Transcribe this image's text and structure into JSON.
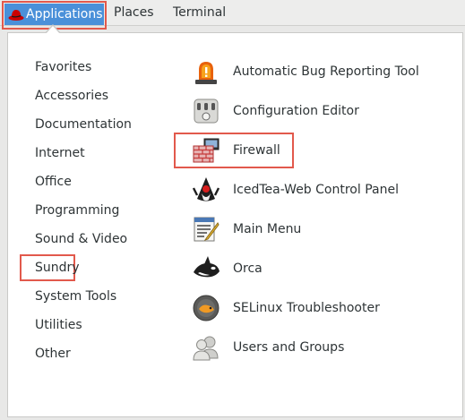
{
  "topbar": {
    "applications_label": "Applications",
    "places_label": "Places",
    "terminal_label": "Terminal"
  },
  "categories": [
    {
      "label": "Favorites"
    },
    {
      "label": "Accessories"
    },
    {
      "label": "Documentation"
    },
    {
      "label": "Internet"
    },
    {
      "label": "Office"
    },
    {
      "label": "Programming"
    },
    {
      "label": "Sound & Video"
    },
    {
      "label": "Sundry",
      "selected": true
    },
    {
      "label": "System Tools"
    },
    {
      "label": "Utilities"
    },
    {
      "label": "Other"
    }
  ],
  "apps": [
    {
      "label": "Automatic Bug Reporting Tool",
      "icon": "siren-icon"
    },
    {
      "label": "Configuration Editor",
      "icon": "settings-sliders-icon"
    },
    {
      "label": "Firewall",
      "icon": "firewall-icon",
      "selected": true
    },
    {
      "label": "IcedTea-Web Control Panel",
      "icon": "java-duke-icon"
    },
    {
      "label": "Main Menu",
      "icon": "menu-editor-icon"
    },
    {
      "label": "Orca",
      "icon": "orca-whale-icon"
    },
    {
      "label": "SELinux Troubleshooter",
      "icon": "selinux-icon"
    },
    {
      "label": "Users and Groups",
      "icon": "users-icon"
    }
  ],
  "colors": {
    "highlight": "#4a90d9",
    "annotation_box": "#e2594c",
    "brand_red": "#cc0000"
  }
}
